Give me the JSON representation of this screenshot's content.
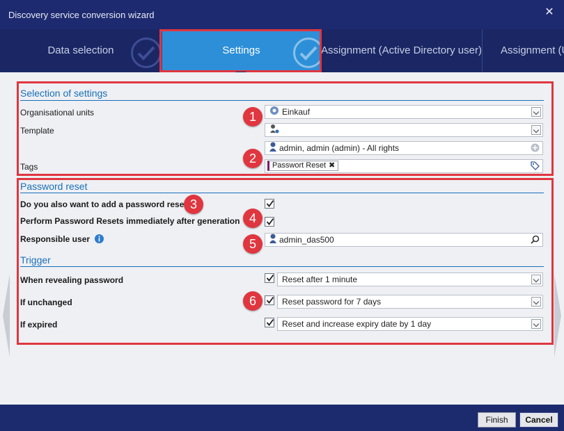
{
  "window": {
    "title": "Discovery service conversion wizard",
    "close_glyph": "✕"
  },
  "tabs": [
    {
      "label": "Data selection"
    },
    {
      "label": "Settings"
    },
    {
      "label": "Assignment (Active Directory user)"
    },
    {
      "label": "Assignment (U"
    }
  ],
  "selection": {
    "title": "Selection of settings",
    "org_units_label": "Organisational units",
    "org_units_value": "Einkauf",
    "template_label": "Template",
    "template_value": "",
    "rights_value": "admin, admin (admin) - All rights",
    "tags_label": "Tags",
    "tag_chip": "Passwort Reset",
    "tag_remove": "✖"
  },
  "password_reset": {
    "title": "Password reset",
    "add_reset_label": "Do you also want to add a password reset?",
    "add_reset_checked": true,
    "immediate_label": "Perform Password Resets immediately after generation",
    "immediate_checked": true,
    "responsible_label": "Responsible user",
    "responsible_value": "admin_das500"
  },
  "trigger": {
    "title": "Trigger",
    "rows": [
      {
        "label": "When revealing password",
        "checked": true,
        "value": "Reset after 1 minute"
      },
      {
        "label": "If unchanged",
        "checked": true,
        "value": "Reset password for 7 days"
      },
      {
        "label": "If expired",
        "checked": true,
        "value": "Reset and increase expiry date by 1 day"
      }
    ]
  },
  "badges": [
    "1",
    "2",
    "3",
    "4",
    "5",
    "6"
  ],
  "footer": {
    "finish_label": "Finish",
    "cancel_label": "Cancel"
  },
  "colors": {
    "accent": "#2d8fd8",
    "highlight": "#e0363f",
    "section": "#1a6fb7",
    "chrome": "#1c2a6e"
  },
  "icons": [
    "close-icon",
    "checkmark-icon",
    "org-unit-icon",
    "template-icon",
    "user-icon",
    "add-icon",
    "tag-icon",
    "info-icon",
    "search-icon",
    "chevron-down-icon"
  ]
}
